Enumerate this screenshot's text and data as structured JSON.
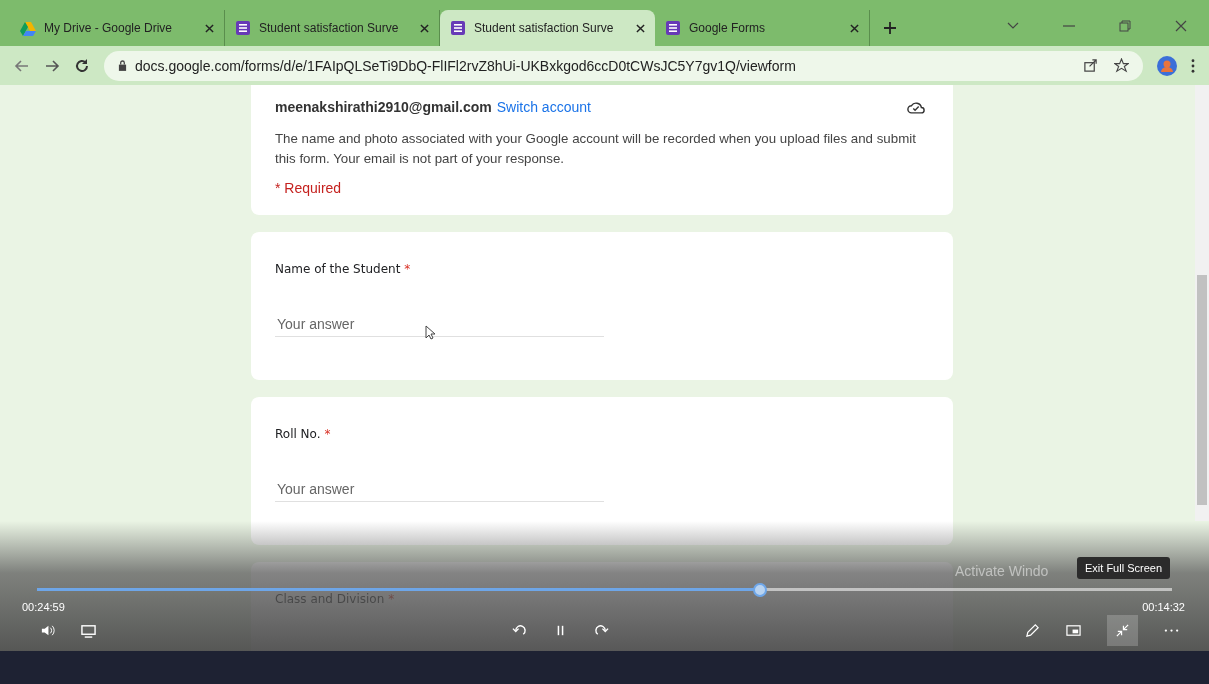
{
  "browser": {
    "tabs": [
      {
        "title": "My Drive - Google Drive",
        "kind": "drive",
        "selected": false
      },
      {
        "title": "Student satisfaction Surve",
        "kind": "forms",
        "selected": false
      },
      {
        "title": "Student satisfaction Surve",
        "kind": "forms",
        "selected": true
      },
      {
        "title": "Google Forms",
        "kind": "forms",
        "selected": false
      }
    ],
    "url": "docs.google.com/forms/d/e/1FAIpQLSeTi9DbQ-FlIFl2rvZ8hUi-UKBxkgod6ccD0tCWsJC5Y7gv1Q/viewform"
  },
  "form": {
    "account": {
      "email": "meenakshirathi2910@gmail.com",
      "switch_link": "Switch account"
    },
    "notice": "The name and photo associated with your Google account will be recorded when you upload files and submit this form. Your email is not part of your response.",
    "required_note": "* Required",
    "questions": [
      {
        "title": "Name of the Student",
        "mark": "*",
        "placeholder": "Your answer"
      },
      {
        "title": "Roll No.",
        "mark": "*",
        "placeholder": "Your answer"
      },
      {
        "title": "Class and Division",
        "mark": "*"
      }
    ]
  },
  "player": {
    "progress": {
      "level": 0.637
    },
    "elapsed": "00:24:59",
    "remaining": "00:14:32",
    "tooltip": "Exit Full Screen",
    "system_overlay": "Activate Windo"
  }
}
